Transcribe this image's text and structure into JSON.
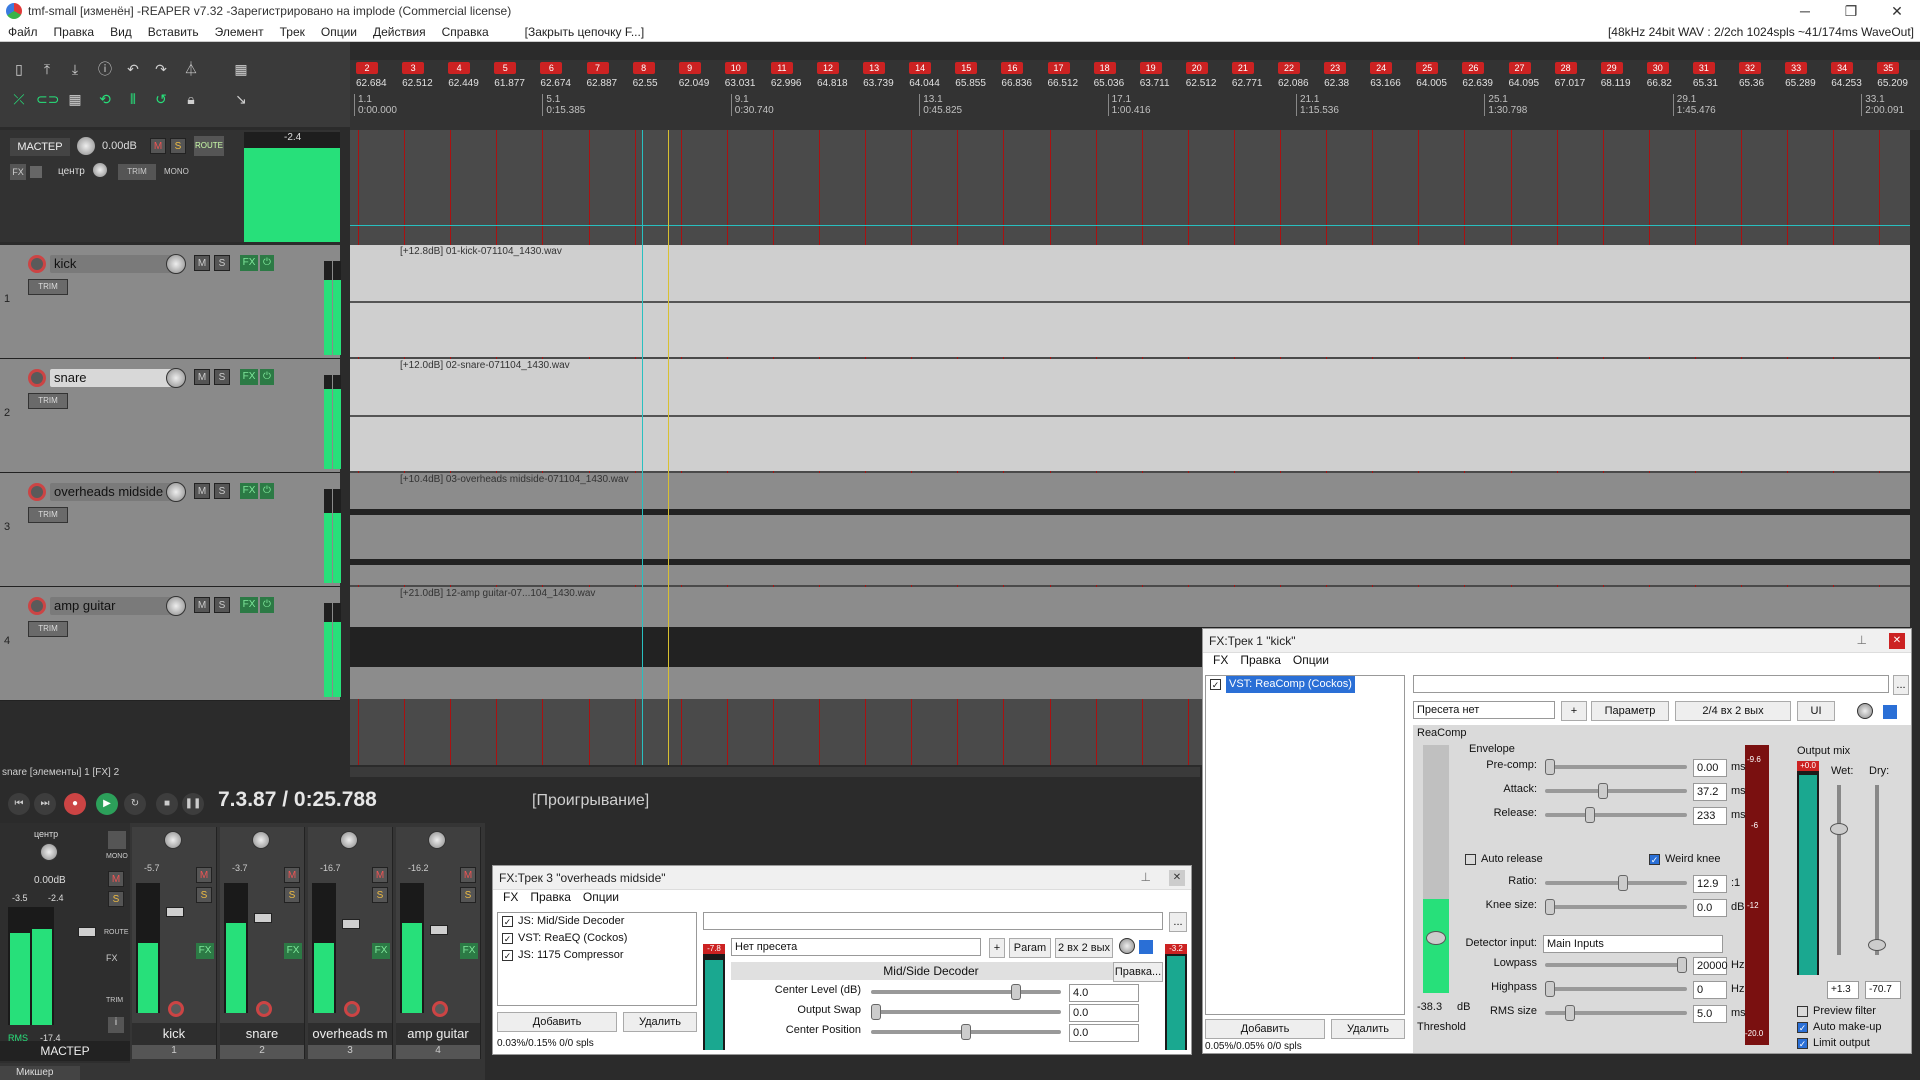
{
  "window": {
    "title": "tmf-small [изменён] -REAPER v7.32 -Зарегистрировано на implode (Commercial license)",
    "audio_status": "[48kHz 24bit WAV : 2/2ch 1024spls ~41/174ms WaveOut]"
  },
  "menu": {
    "items": [
      "Файл",
      "Правка",
      "Вид",
      "Вставить",
      "Элемент",
      "Трек",
      "Опции",
      "Действия",
      "Справка"
    ],
    "extra": "[Закрыть цепочку F...]"
  },
  "ruler": {
    "markers": [
      "2",
      "3",
      "4",
      "5",
      "6",
      "7",
      "8",
      "9",
      "10",
      "11",
      "12",
      "13",
      "14",
      "15",
      "16",
      "17",
      "18",
      "19",
      "20",
      "21",
      "22",
      "23",
      "24",
      "25",
      "26",
      "27",
      "28",
      "29",
      "30",
      "31",
      "32",
      "33",
      "34",
      "35"
    ],
    "tempos": [
      "62.684",
      "62.512",
      "62.449",
      "61.877",
      "62.674",
      "62.887",
      "62.55",
      "62.049",
      "63.031",
      "62.996",
      "64.818",
      "63.739",
      "64.044",
      "65.855",
      "66.836",
      "66.512",
      "65.036",
      "63.711",
      "62.512",
      "62.771",
      "62.086",
      "62.38",
      "63.166",
      "64.005",
      "62.639",
      "64.095",
      "67.017",
      "68.119",
      "66.82",
      "65.31",
      "65.36",
      "65.289",
      "64.253",
      "65.209"
    ],
    "bars": [
      {
        "bar": "1.1",
        "time": "0:00.000"
      },
      {
        "bar": "5.1",
        "time": "0:15.385"
      },
      {
        "bar": "9.1",
        "time": "0:30.740"
      },
      {
        "bar": "13.1",
        "time": "0:45.825"
      },
      {
        "bar": "17.1",
        "time": "1:00.416"
      },
      {
        "bar": "21.1",
        "time": "1:15.536"
      },
      {
        "bar": "25.1",
        "time": "1:30.798"
      },
      {
        "bar": "29.1",
        "time": "1:45.476"
      },
      {
        "bar": "33.1",
        "time": "2:00.091"
      }
    ]
  },
  "master": {
    "label": "МАСТЕР",
    "volume": "0.00dB",
    "pan": "центр",
    "route": "ROUTE",
    "trim": "TRIM",
    "mono": "MONO",
    "fx": "FX",
    "peak": "-2.4",
    "scale": [
      "-6",
      "-18",
      "-30",
      "-42",
      "-54"
    ]
  },
  "tracks": [
    {
      "num": "1",
      "name": "kick",
      "item": "[+12.8dB] 01-kick-071104_1430.wav",
      "level": 0.8
    },
    {
      "num": "2",
      "name": "snare",
      "item": "[+12.0dB] 02-snare-071104_1430.wav",
      "level": 0.85
    },
    {
      "num": "3",
      "name": "overheads midside",
      "item": "[+10.4dB] 03-overheads midside-071104_1430.wav",
      "level": 0.75
    },
    {
      "num": "4",
      "name": "amp guitar",
      "item": "[+21.0dB] 12-amp guitar-07...104_1430.wav",
      "level": 0.8
    }
  ],
  "track_buttons": {
    "mute": "M",
    "solo": "S",
    "fx": "FX",
    "trim": "TRIM",
    "item_m": "M",
    "item_fx": "FX"
  },
  "status_left": "snare [элементы] 1 [FX] 2",
  "transport": {
    "position": "7.3.87 / 0:25.788",
    "state": "[Проигрывание]"
  },
  "mixer": {
    "master_label": "МАСТЕР",
    "master_pan": "центр",
    "master_vol": "0.00dB",
    "master_peaks": [
      "-3.5",
      "-2.4"
    ],
    "rms_label": "RMS",
    "rms_value": "-17.4",
    "mono": "MONO",
    "route": "ROUTE",
    "trim": "TRIM",
    "fx": "FX",
    "channels": [
      {
        "name": "kick",
        "num": "1",
        "peak": "-5.7"
      },
      {
        "name": "snare",
        "num": "2",
        "peak": "-3.7"
      },
      {
        "name": "overheads m",
        "num": "3",
        "peak": "-16.7"
      },
      {
        "name": "amp guitar",
        "num": "4",
        "peak": "-16.2"
      }
    ],
    "tab": "Микшер",
    "meter_scale": [
      "-6",
      "-12",
      "-18",
      "-24",
      "-30",
      "-36",
      "-42",
      "-48",
      "-54"
    ]
  },
  "fx3": {
    "title": "FX:Трек 3 \"overheads midside\"",
    "menu": [
      "FX",
      "Правка",
      "Опции"
    ],
    "chain": [
      "JS: Mid/Side Decoder",
      "VST: ReaEQ (Cockos)",
      "JS: 1175 Compressor"
    ],
    "preset": "Нет пресета",
    "plus": "+",
    "param": "Param",
    "io": "2 вх 2 вых",
    "plugin_name": "Mid/Side Decoder",
    "edit": "Правка...",
    "params": [
      {
        "label": "Center Level (dB)",
        "value": "4.0",
        "pos": 0.78
      },
      {
        "label": "Output Swap",
        "value": "0.0",
        "pos": 0.0
      },
      {
        "label": "Center Position",
        "value": "0.0",
        "pos": 0.5
      }
    ],
    "add": "Добавить",
    "remove": "Удалить",
    "cpu": "0.03%/0.15% 0/0 spls",
    "in_peak": "-7.8",
    "out_peak": "-3.2",
    "dots": "..."
  },
  "fx1": {
    "title": "FX:Трек 1 \"kick\"",
    "menu": [
      "FX",
      "Правка",
      "Опции"
    ],
    "chain": [
      "VST: ReaComp (Cockos)"
    ],
    "preset": "Пресета нет",
    "plus": "+",
    "param": "Параметр",
    "io": "2/4 вх 2 вых",
    "ui": "UI",
    "plugin": "ReaComp",
    "envelope": "Envelope",
    "precomp": {
      "label": "Pre-comp:",
      "value": "0.00",
      "unit": "ms",
      "pos": 0.0
    },
    "attack": {
      "label": "Attack:",
      "value": "37.2",
      "unit": "ms",
      "pos": 0.4
    },
    "release": {
      "label": "Release:",
      "value": "233",
      "unit": "ms",
      "pos": 0.3
    },
    "auto_release": "Auto release",
    "weird_knee": "Weird knee",
    "ratio": {
      "label": "Ratio:",
      "value": "12.9",
      "unit": ":1",
      "pos": 0.55
    },
    "knee": {
      "label": "Knee size:",
      "value": "0.0",
      "unit": "dB",
      "pos": 0.0
    },
    "detector_label": "Detector input:",
    "detector": "Main Inputs",
    "lowpass": {
      "label": "Lowpass",
      "value": "20000",
      "unit": "Hz",
      "pos": 1.0
    },
    "highpass": {
      "label": "Highpass",
      "value": "0",
      "unit": "Hz",
      "pos": 0.0
    },
    "rms": {
      "label": "RMS size",
      "value": "5.0",
      "unit": "ms",
      "pos": 0.15
    },
    "threshold": {
      "label": "Threshold",
      "value": "-38.3",
      "unit": "dB"
    },
    "gr_scale": [
      "-9.6",
      "-6",
      "-12",
      "-20.0"
    ],
    "output_mix": "Output mix",
    "wet": "Wet:",
    "dry": "Dry:",
    "wet_value": "+1.3",
    "dry_value": "-70.7",
    "out_peak": "+0.0",
    "out_scale": [
      "-6",
      "-12",
      "-18",
      "-24",
      "-30",
      "-36",
      "-42",
      "-48",
      "-54",
      "-60"
    ],
    "preview_filter": "Preview filter",
    "auto_makeup": "Auto make-up",
    "limit_output": "Limit output",
    "add": "Добавить",
    "remove": "Удалить",
    "cpu": "0.05%/0.05% 0/0 spls",
    "dots": "..."
  },
  "colors": {
    "accent_green": "#27e07a",
    "marker_red": "#cc2222",
    "cursor": "#28c0c0"
  }
}
